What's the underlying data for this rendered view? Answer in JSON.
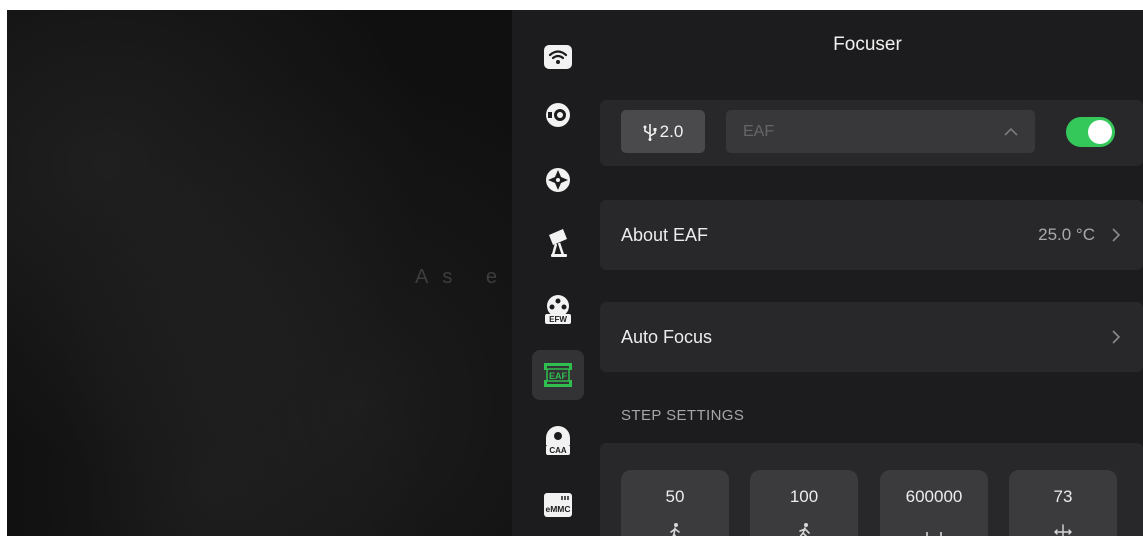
{
  "backdrop": {
    "text": "As e"
  },
  "sidebar": {
    "items": [
      {
        "icon": "wifi-icon",
        "active": false
      },
      {
        "icon": "camera-lens-icon",
        "active": false
      },
      {
        "icon": "mount-crosshair-icon",
        "active": false
      },
      {
        "icon": "telescope-icon",
        "active": false
      },
      {
        "icon": "filter-wheel-icon",
        "badge": "EFW",
        "active": false
      },
      {
        "icon": "focuser-icon",
        "badge": "EAF",
        "active": true
      },
      {
        "icon": "rotator-icon",
        "badge": "CAA",
        "active": false
      },
      {
        "icon": "storage-chip-icon",
        "badge": "eMMC",
        "active": false
      }
    ]
  },
  "header": {
    "title": "Focuser"
  },
  "connection": {
    "usb_label": "2.0",
    "device_value": "EAF",
    "enabled": true
  },
  "about_row": {
    "label": "About EAF",
    "value": "25.0 °C"
  },
  "autofocus_row": {
    "label": "Auto Focus"
  },
  "step_settings": {
    "heading": "STEP SETTINGS",
    "tiles": [
      {
        "value": "50",
        "icon": "walk-slow-icon"
      },
      {
        "value": "100",
        "icon": "walk-fast-icon"
      },
      {
        "value": "600000",
        "icon": "max-step-icon"
      },
      {
        "value": "73",
        "icon": "backlash-icon"
      }
    ]
  },
  "colors": {
    "accent": "#34c85a",
    "focuser_icon": "#2fbf4f",
    "panel": "#1c1c1e",
    "card": "#28282b"
  }
}
